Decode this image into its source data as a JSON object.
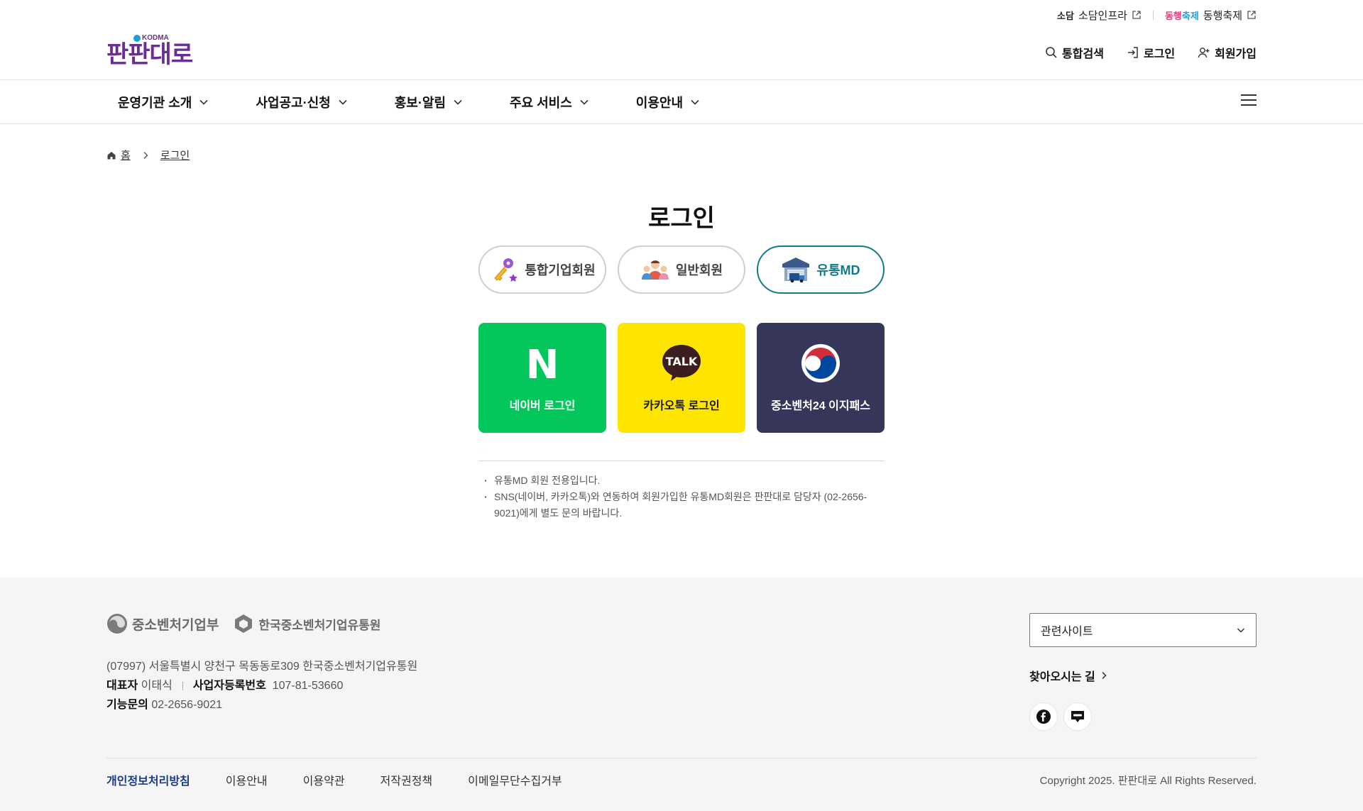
{
  "util": {
    "sodam_logo": "소담",
    "sodam_label": "소담인프라",
    "dong_logo_a": "동행",
    "dong_logo_b": "축제",
    "dong_label": "동행축제"
  },
  "brand": {
    "name": "판판대로",
    "badge": "KODMA"
  },
  "member_nav": {
    "search": "통합검색",
    "login": "로그인",
    "signup": "회원가입"
  },
  "gnb": {
    "items": [
      "운영기관 소개",
      "사업공고·신청",
      "홍보·알림",
      "주요 서비스",
      "이용안내"
    ]
  },
  "breadcrumb": {
    "home": "홈",
    "current": "로그인"
  },
  "login": {
    "title": "로그인",
    "tabs": [
      "통합기업회원",
      "일반회원",
      "유통MD"
    ],
    "active_tab": "유통MD",
    "sns": {
      "naver": "네이버 로그인",
      "naver_mark": "N",
      "kakao": "카카오톡 로그인",
      "kakao_mark": "TALK",
      "gov": "중소벤처24 이지패스"
    },
    "notices": [
      "유통MD 회원 전용입니다.",
      "SNS(네이버, 카카오톡)와 연동하여 회원가입한 유통MD회원은 판판대로 담당자 (02-2656-9021)에게 별도 문의 바랍니다."
    ]
  },
  "footer": {
    "logo_mss": "중소벤처기업부",
    "logo_kodma": "한국중소벤처기업유통원",
    "address": "(07997) 서울특별시 양천구 목동동로309 한국중소벤처기업유통원",
    "ceo_label": "대표자",
    "ceo": "이태식",
    "biz_label": "사업자등록번호",
    "biz_no": "107-81-53660",
    "contact_label": "기능문의",
    "contact": "02-2656-9021",
    "related_sites": "관련사이트",
    "directions": "찾아오시는 길",
    "links": [
      "개인정보처리방침",
      "이용안내",
      "이용약관",
      "저작권정책",
      "이메일무단수집거부"
    ],
    "copyright": "Copyright 2025. 판판대로 All Rights Reserved."
  },
  "colors": {
    "brand_purple": "#6a2d91",
    "active_teal": "#137a8a",
    "naver_green": "#03c75a",
    "kakao_yellow": "#fee500",
    "gov_navy": "#36365a",
    "privacy_blue": "#1b3a8a"
  },
  "icons": [
    "external-link-icon",
    "search-icon",
    "login-icon",
    "user-plus-icon",
    "chevron-down-icon",
    "hamburger-icon",
    "home-icon",
    "chevron-right-icon",
    "key-icon",
    "people-icon",
    "warehouse-truck-icon",
    "naver-n-icon",
    "kakao-talk-icon",
    "taegeuk-icon",
    "facebook-icon",
    "blog-icon"
  ]
}
